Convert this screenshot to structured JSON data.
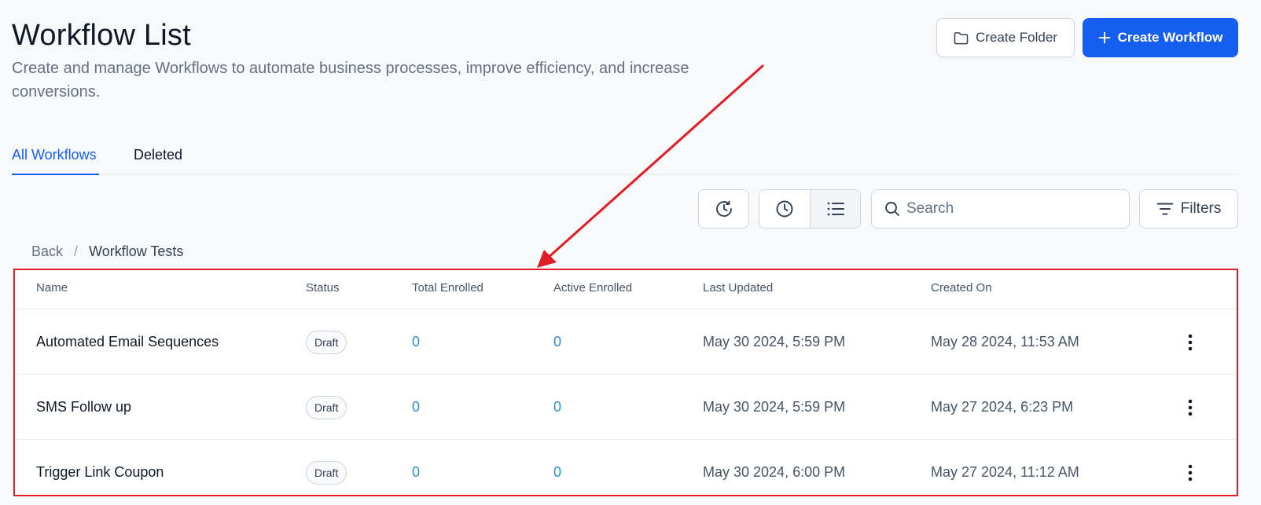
{
  "header": {
    "title": "Workflow List",
    "subtitle": "Create and manage Workflows to automate business processes, improve efficiency, and increase conversions.",
    "create_folder_label": "Create Folder",
    "create_workflow_label": "Create Workflow"
  },
  "tabs": [
    {
      "label": "All Workflows",
      "active": true
    },
    {
      "label": "Deleted",
      "active": false
    }
  ],
  "toolbar": {
    "search_placeholder": "Search",
    "filters_label": "Filters"
  },
  "breadcrumb": {
    "back": "Back",
    "separator": "/",
    "current": "Workflow Tests"
  },
  "table": {
    "columns": [
      "Name",
      "Status",
      "Total Enrolled",
      "Active Enrolled",
      "Last Updated",
      "Created On"
    ],
    "rows": [
      {
        "name": "Automated Email Sequences",
        "status": "Draft",
        "total": "0",
        "active": "0",
        "updated": "May 30 2024, 5:59 PM",
        "created": "May 28 2024, 11:53 AM"
      },
      {
        "name": "SMS Follow up",
        "status": "Draft",
        "total": "0",
        "active": "0",
        "updated": "May 30 2024, 5:59 PM",
        "created": "May 27 2024, 6:23 PM"
      },
      {
        "name": "Trigger Link Coupon",
        "status": "Draft",
        "total": "0",
        "active": "0",
        "updated": "May 30 2024, 6:00 PM",
        "created": "May 27 2024, 11:12 AM"
      }
    ]
  },
  "colors": {
    "primary": "#155eef",
    "annotation_red": "#e01e26",
    "link_number": "#2e90c8"
  }
}
